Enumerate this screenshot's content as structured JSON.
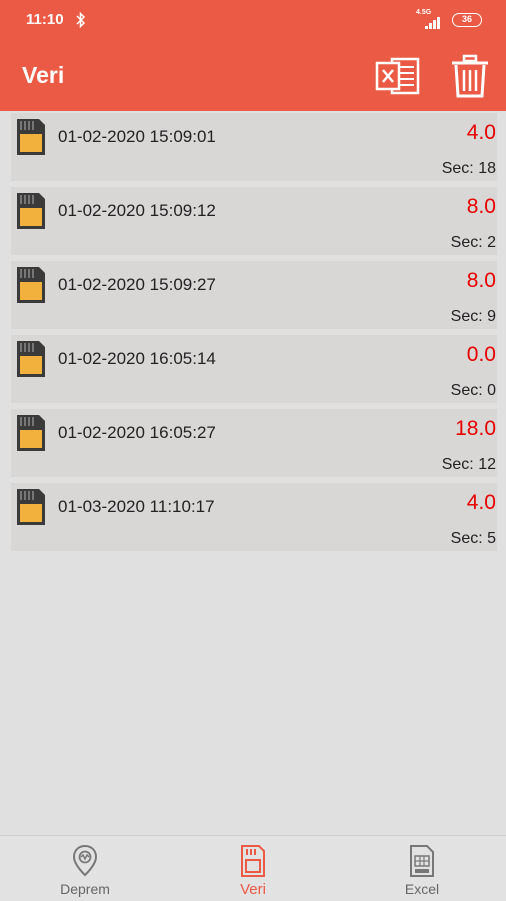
{
  "status_bar": {
    "time": "11:10",
    "network": "4.5G",
    "battery": "36"
  },
  "app_bar": {
    "title": "Veri"
  },
  "colors": {
    "accent": "#ea5a44",
    "value": "#e60000",
    "row_bg": "#d9d6d6",
    "sd_card": "#f2b03c"
  },
  "records": [
    {
      "date": "01-02-2020 15:09:01",
      "value": "4.0",
      "sec": "Sec: 18"
    },
    {
      "date": "01-02-2020 15:09:12",
      "value": "8.0",
      "sec": "Sec: 2"
    },
    {
      "date": "01-02-2020 15:09:27",
      "value": "8.0",
      "sec": "Sec: 9"
    },
    {
      "date": "01-02-2020 16:05:14",
      "value": "0.0",
      "sec": "Sec: 0"
    },
    {
      "date": "01-02-2020 16:05:27",
      "value": "18.0",
      "sec": "Sec: 12"
    },
    {
      "date": "01-03-2020 11:10:17",
      "value": "4.0",
      "sec": "Sec: 5"
    }
  ],
  "bottom_nav": {
    "items": [
      {
        "label": "Deprem",
        "icon": "location-pin-icon"
      },
      {
        "label": "Veri",
        "icon": "sd-card-icon"
      },
      {
        "label": "Excel",
        "icon": "xls-file-icon"
      }
    ],
    "active": "Veri"
  }
}
